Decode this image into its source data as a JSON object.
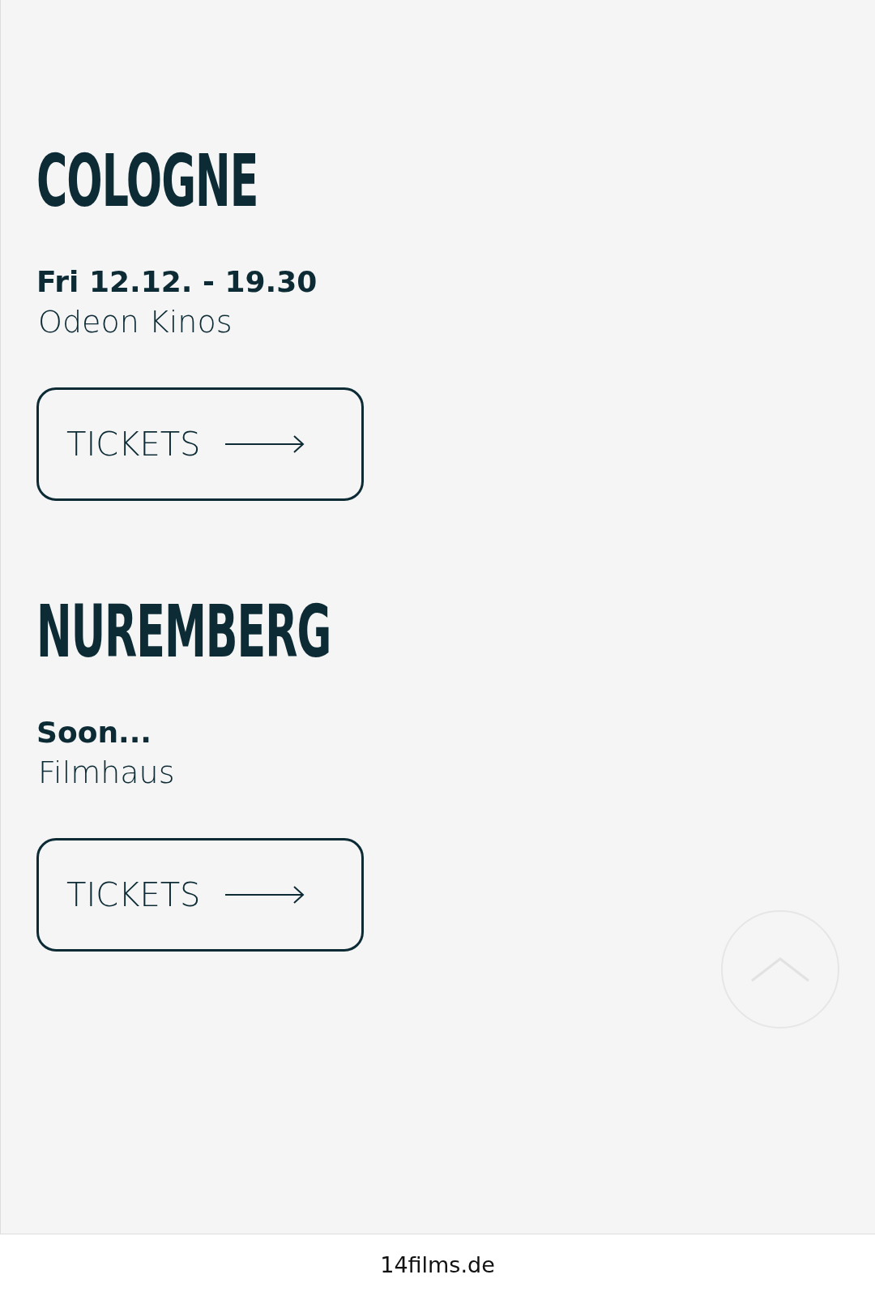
{
  "screenings": [
    {
      "city": "COLOGNE",
      "date": "Fri 12.12. - 19.30",
      "venue": "Odeon Kinos",
      "button": "TICKETS"
    },
    {
      "city": "NUREMBERG",
      "date": "Soon...",
      "venue": "Filmhaus",
      "button": "TICKETS"
    }
  ],
  "address_bar": {
    "url": "14films.de"
  }
}
